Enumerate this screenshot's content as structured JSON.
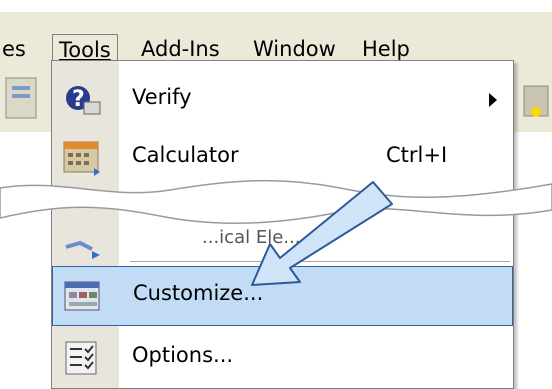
{
  "menubar": {
    "items": [
      {
        "label": "es"
      },
      {
        "label": "Tools",
        "active": true
      },
      {
        "label": "Add-Ins"
      },
      {
        "label": "Window"
      },
      {
        "label": "Help"
      }
    ]
  },
  "tools_menu": {
    "items": [
      {
        "label": "Verify",
        "icon": "verify-icon",
        "has_submenu": true
      },
      {
        "label": "Calculator",
        "icon": "calculator-icon",
        "shortcut": "Ctrl+I"
      },
      {
        "label": "...ical Ele...",
        "icon": "partial-icon"
      },
      {
        "label": "Customize...",
        "icon": "customize-icon",
        "highlighted": true
      },
      {
        "label": "Options...",
        "icon": "options-icon"
      }
    ]
  },
  "colors": {
    "menubar_bg": "#ece9d8",
    "highlight_bg": "#c2dcf5",
    "highlight_border": "#3163a7",
    "callout_arrow": "#cfe5f7"
  }
}
